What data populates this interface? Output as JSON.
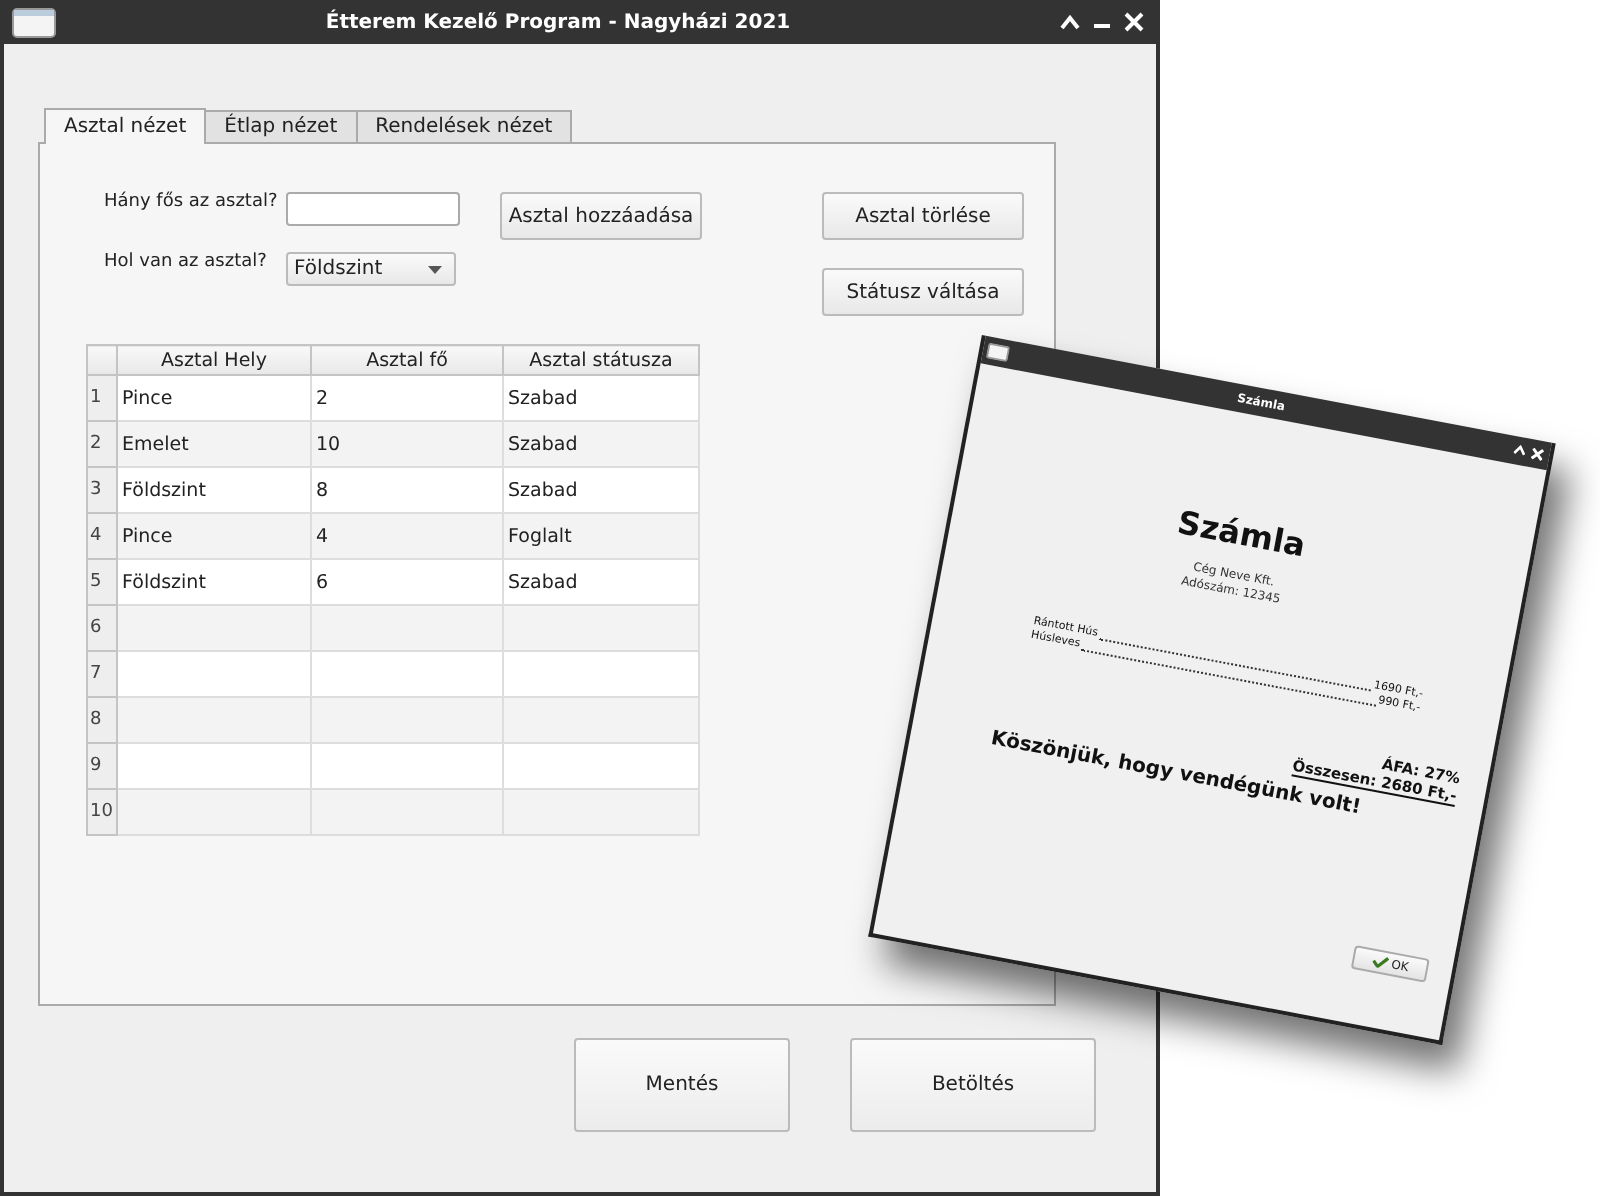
{
  "main_window": {
    "title": "Étterem Kezelő Program - Nagyházi 2021",
    "tabs": [
      {
        "label": "Asztal nézet",
        "selected": true
      },
      {
        "label": "Étlap nézet",
        "selected": false
      },
      {
        "label": "Rendelések nézet",
        "selected": false
      }
    ],
    "form": {
      "guests_label": "Hány fős az asztal?",
      "location_label": "Hol van az asztal?",
      "location_value": "Földszint"
    },
    "action_buttons": [
      "Asztal hozzáadása",
      "Asztal törlése",
      "Státusz váltása"
    ],
    "table": {
      "columns": [
        "Asztal Hely",
        "Asztal fő",
        "Asztal státusza"
      ],
      "rows": [
        {
          "number": "1",
          "cells": [
            "Pince",
            "2",
            "Szabad"
          ]
        },
        {
          "number": "2",
          "cells": [
            "Emelet",
            "10",
            "Szabad"
          ]
        },
        {
          "number": "3",
          "cells": [
            "Földszint",
            "8",
            "Szabad"
          ]
        },
        {
          "number": "4",
          "cells": [
            "Pince",
            "4",
            "Foglalt"
          ]
        },
        {
          "number": "5",
          "cells": [
            "Földszint",
            "6",
            "Szabad"
          ]
        },
        {
          "number": "6"
        },
        {
          "number": "7"
        },
        {
          "number": "8"
        },
        {
          "number": "9"
        },
        {
          "number": "10"
        }
      ]
    },
    "bottom_buttons": [
      "Mentés",
      "Betöltés"
    ]
  },
  "bill_dialog": {
    "title": "Számla",
    "heading": "Számla",
    "company": "Cég Neve Kft.",
    "tax_id": "Adószám: 12345",
    "items": [
      {
        "name": "Rántott Hús",
        "price": "1690 Ft,-"
      },
      {
        "name": "Húsleves",
        "price": "990 Ft,-"
      }
    ],
    "vat": "ÁFA: 27%",
    "total": "Összesen: 2680 Ft,-",
    "thanks": "Köszönjük, hogy vendégünk volt!",
    "ok_button": "OK"
  }
}
